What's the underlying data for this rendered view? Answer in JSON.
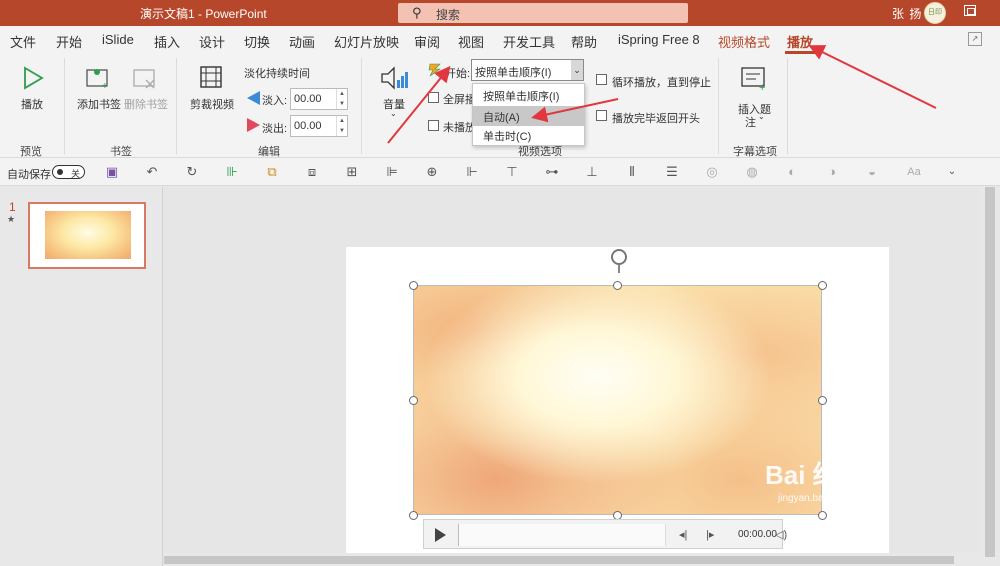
{
  "titlebar": {
    "doc_title": "演示文稿1  -  PowerPoint",
    "search_label": "搜索",
    "search_icon": "search-icon",
    "user_name": "张 扬",
    "avatar_text": "日印记"
  },
  "menu": {
    "tabs": [
      "文件",
      "开始",
      "iSlide",
      "插入",
      "设计",
      "切换",
      "动画",
      "幻灯片放映",
      "审阅",
      "视图",
      "开发工具",
      "帮助",
      "iSpring Free 8",
      "视频格式",
      "播放"
    ]
  },
  "ribbon": {
    "preview": {
      "play_label": "播放",
      "group": "预览"
    },
    "bookmarks": {
      "add_label": "添加书签",
      "remove_label": "删除书签",
      "group": "书签"
    },
    "editing": {
      "trim_label": "剪裁视频",
      "fade_title": "淡化持续时间",
      "fade_in_label": "淡入:",
      "fade_in_value": "00.00",
      "fade_out_label": "淡出:",
      "fade_out_value": "00.00",
      "group": "编辑"
    },
    "video_options": {
      "volume_label": "音量",
      "start_label": "开始:",
      "start_value": "按照单击顺序(I)",
      "fullscreen_label": "全屏播",
      "hide_label": "未播放",
      "loop_label": "循环播放，直到停止",
      "rewind_label": "播放完毕返回开头",
      "group": "视频选项",
      "dropdown_options": [
        "按照单击顺序(I)",
        "自动(A)",
        "单击时(C)"
      ]
    },
    "captions": {
      "insert_label": "插入题",
      "insert_label2": "注",
      "group": "字幕选项"
    }
  },
  "qat": {
    "autosave_label": "自动保存",
    "toggle_label": "关",
    "font_btn": "Aa"
  },
  "slides": {
    "slide_number": "1",
    "transition_mark": "★"
  },
  "player": {
    "time": "00:00.00"
  },
  "watermark": {
    "text": "Bai 经验",
    "url": "jingyan.baidu.com"
  },
  "colors": {
    "accent": "#b7472a",
    "annotation_arrow": "#e0383e"
  }
}
